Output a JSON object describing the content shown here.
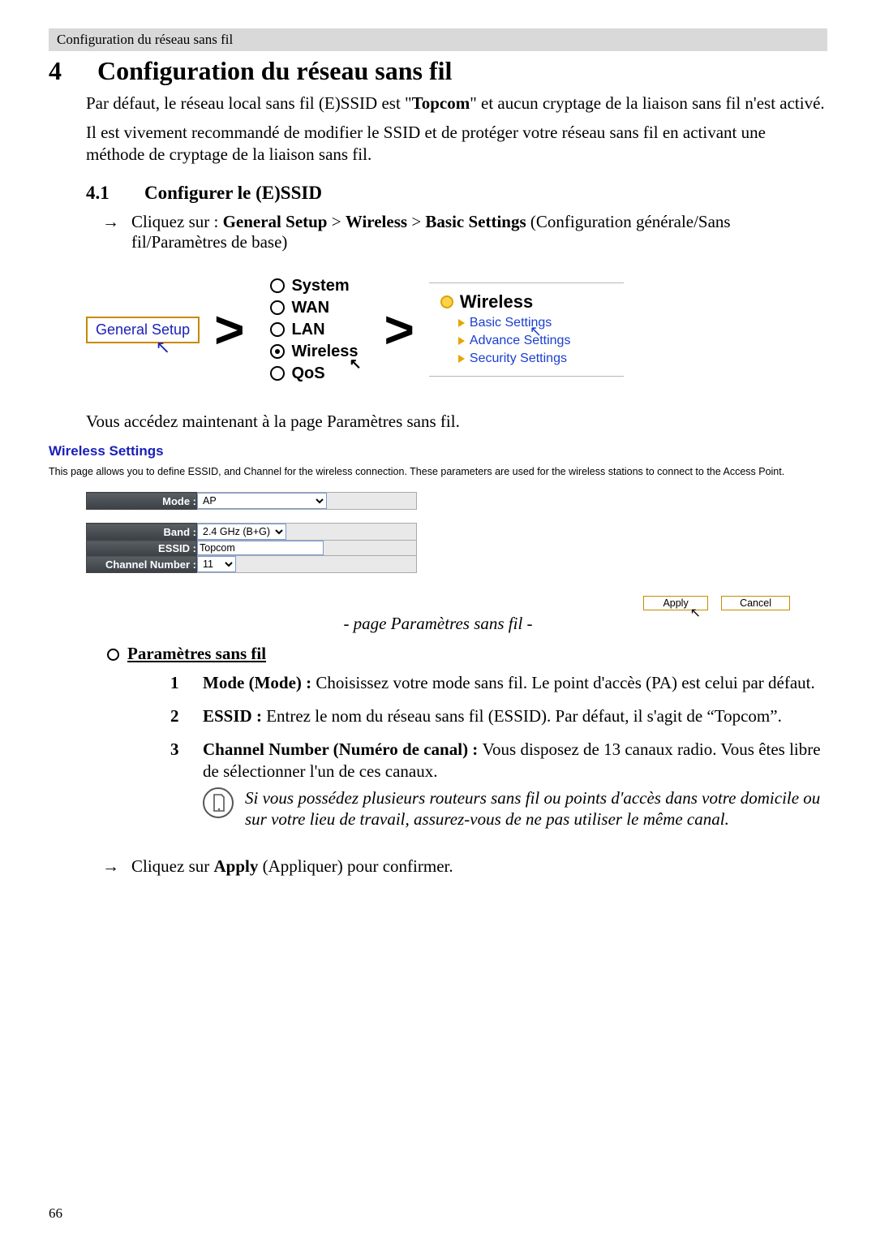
{
  "running_header": "Configuration du réseau sans fil",
  "chapter": {
    "num": "4",
    "title": "Configuration du réseau sans fil"
  },
  "intro1a": "Par défaut, le réseau local sans fil (E)SSID est \"",
  "intro1_bold": "Topcom",
  "intro1b": "\" et aucun cryptage de la liaison sans fil n'est activé.",
  "intro2": "Il est vivement recommandé de modifier le SSID et de protéger votre réseau sans fil en activant une méthode de cryptage de la liaison sans fil.",
  "section41": {
    "num": "4.1",
    "title": "Configurer le (E)SSID"
  },
  "step1": {
    "pre": "Cliquez sur : ",
    "b1": "General Setup",
    "sep": " > ",
    "b2": "Wireless",
    "b3": "Basic Settings",
    "post": " (Configuration générale/Sans fil/Paramètres de base)"
  },
  "nav": {
    "general_setup": "General Setup",
    "menu": {
      "system": "System",
      "wan": "WAN",
      "lan": "LAN",
      "wireless": "Wireless",
      "qos": "QoS"
    },
    "wireless_head": "Wireless",
    "subs": {
      "basic": "Basic Settings",
      "advanced": "Advance Settings",
      "security": "Security Settings"
    }
  },
  "after_nav": "Vous accédez maintenant à la page Paramètres sans fil.",
  "ws": {
    "title": "Wireless Settings",
    "desc": "This page allows you to define ESSID, and Channel for the wireless connection. These parameters are used for the wireless stations to connect to the Access Point.",
    "labels": {
      "mode": "Mode :",
      "band": "Band :",
      "essid": "ESSID :",
      "channel": "Channel Number :"
    },
    "values": {
      "mode": "AP",
      "band": "2.4 GHz (B+G)",
      "essid": "Topcom",
      "channel": "11"
    },
    "apply": "Apply",
    "cancel": "Cancel"
  },
  "fig_caption": "- page Paramètres sans fil -",
  "psf_heading": "Paramètres sans fil",
  "list": {
    "i1_b": "Mode (Mode) : ",
    "i1_t": "Choisissez votre mode sans fil. Le point d'accès (PA) est celui par défaut.",
    "i2_b": "ESSID : ",
    "i2_t": "Entrez le nom du réseau sans fil (ESSID). Par défaut, il s'agit de “Topcom”.",
    "i3_b": "Channel Number (Numéro de canal) : ",
    "i3_t": "Vous disposez de 13 canaux radio. Vous êtes libre de sélectionner l'un de ces canaux."
  },
  "note": "Si vous possédez plusieurs routeurs sans fil ou points d'accès dans votre domicile ou sur votre lieu de travail, assurez-vous de ne pas utiliser le même canal.",
  "final_step_pre": "Cliquez sur ",
  "final_step_b": "Apply",
  "final_step_post": " (Appliquer) pour confirmer.",
  "page_no": "66"
}
